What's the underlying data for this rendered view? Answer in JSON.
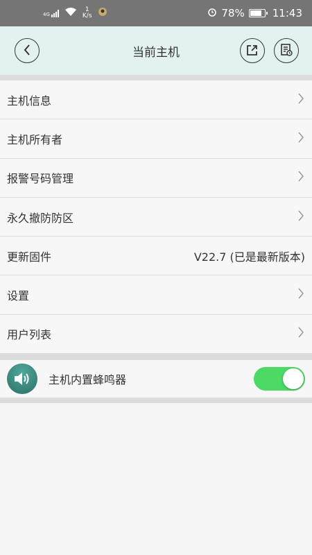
{
  "status_bar": {
    "network": "4G",
    "speed_value": "1",
    "speed_unit": "K/s",
    "battery": "78%",
    "time": "11:43"
  },
  "header": {
    "title": "当前主机"
  },
  "menu": {
    "items": [
      {
        "label": "主机信息"
      },
      {
        "label": "主机所有者"
      },
      {
        "label": "报警号码管理"
      },
      {
        "label": "永久撤防防区"
      },
      {
        "label": "更新固件",
        "value": "V22.7 (已是最新版本)"
      },
      {
        "label": "设置"
      },
      {
        "label": "用户列表"
      }
    ]
  },
  "buzzer": {
    "label": "主机内置蜂鸣器",
    "enabled": true,
    "toggle_color": "#4cd964"
  },
  "colors": {
    "header_bg": "#e3f2f1",
    "status_bg": "#757575",
    "accent": "#4cd964"
  }
}
